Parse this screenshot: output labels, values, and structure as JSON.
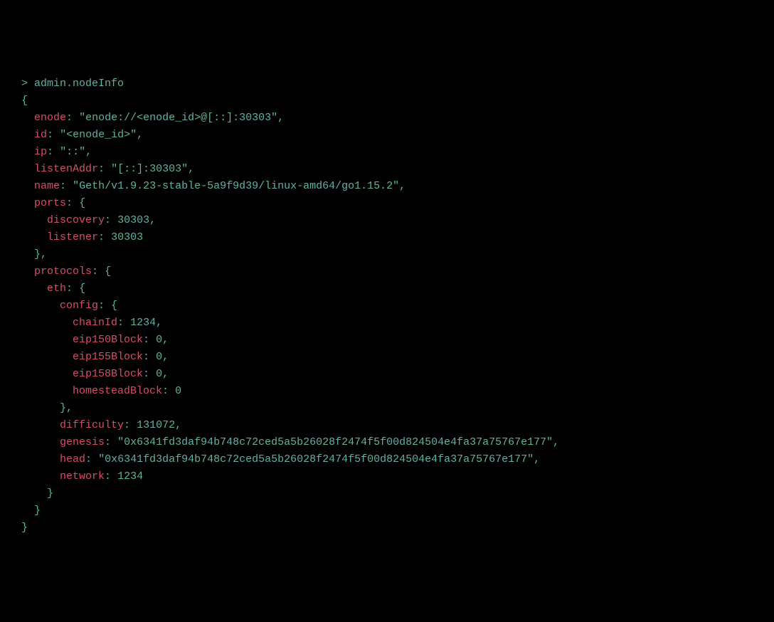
{
  "prompt": {
    "symbol": "> ",
    "command": "admin.nodeInfo"
  },
  "nodeInfo": {
    "enode": {
      "key": "enode",
      "value": "\"enode://<enode_id>@[::]:30303\""
    },
    "id": {
      "key": "id",
      "value": "\"<enode_id>\""
    },
    "ip": {
      "key": "ip",
      "value": "\"::\""
    },
    "listenAddr": {
      "key": "listenAddr",
      "value": "\"[::]:30303\""
    },
    "name": {
      "key": "name",
      "value": "\"Geth/v1.9.23-stable-5a9f9d39/linux-amd64/go1.15.2\""
    },
    "ports": {
      "key": "ports",
      "discovery": {
        "key": "discovery",
        "value": "30303"
      },
      "listener": {
        "key": "listener",
        "value": "30303"
      }
    },
    "protocols": {
      "key": "protocols",
      "eth": {
        "key": "eth",
        "config": {
          "key": "config",
          "chainId": {
            "key": "chainId",
            "value": "1234"
          },
          "eip150Block": {
            "key": "eip150Block",
            "value": "0"
          },
          "eip155Block": {
            "key": "eip155Block",
            "value": "0"
          },
          "eip158Block": {
            "key": "eip158Block",
            "value": "0"
          },
          "homesteadBlock": {
            "key": "homesteadBlock",
            "value": "0"
          }
        },
        "difficulty": {
          "key": "difficulty",
          "value": "131072"
        },
        "genesis": {
          "key": "genesis",
          "value": "\"0x6341fd3daf94b748c72ced5a5b26028f2474f5f00d824504e4fa37a75767e177\""
        },
        "head": {
          "key": "head",
          "value": "\"0x6341fd3daf94b748c72ced5a5b26028f2474f5f00d824504e4fa37a75767e177\""
        },
        "network": {
          "key": "network",
          "value": "1234"
        }
      }
    }
  },
  "syntax": {
    "colon": ":",
    "comma": ",",
    "openBrace": "{",
    "closeBrace": "}",
    "closeBraceComma": "},"
  }
}
